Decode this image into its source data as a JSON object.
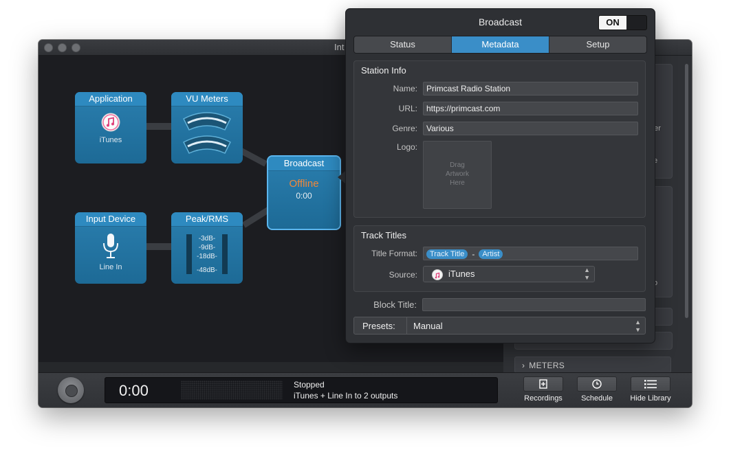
{
  "window": {
    "title": "Int"
  },
  "nodes": {
    "application": {
      "title": "Application",
      "sub": "iTunes"
    },
    "vu_meters": {
      "title": "VU Meters"
    },
    "input_device": {
      "title": "Input Device",
      "sub": "Line In"
    },
    "peak_rms": {
      "title": "Peak/RMS",
      "db_labels": [
        "-3dB-",
        "-9dB-",
        "-18dB-",
        "-48dB-"
      ]
    },
    "broadcast": {
      "title": "Broadcast",
      "status": "Offline",
      "time": "0:00"
    }
  },
  "library": {
    "fragments": [
      "ther",
      "e",
      "o"
    ],
    "meters_label": "METERS",
    "meters_chevron": "›"
  },
  "transport": {
    "time": "0:00",
    "status": "Stopped",
    "description": "iTunes + Line In to 2 outputs",
    "tools": [
      {
        "label": "Recordings",
        "icon": "recordings-icon"
      },
      {
        "label": "Schedule",
        "icon": "clock-icon"
      },
      {
        "label": "Hide Library",
        "icon": "list-icon"
      }
    ]
  },
  "popover": {
    "title": "Broadcast",
    "toggle": "ON",
    "tabs": [
      "Status",
      "Metadata",
      "Setup"
    ],
    "active_tab": "Metadata",
    "station_info": {
      "title": "Station Info",
      "name_label": "Name:",
      "name_value": "Primcast Radio Station",
      "url_label": "URL:",
      "url_value": "https://primcast.com",
      "genre_label": "Genre:",
      "genre_value": "Various",
      "logo_label": "Logo:",
      "logo_placeholder_1": "Drag",
      "logo_placeholder_2": "Artwork",
      "logo_placeholder_3": "Here"
    },
    "track_titles": {
      "title": "Track Titles",
      "format_label": "Title Format:",
      "token_1": "Track Title",
      "separator": "-",
      "token_2": "Artist",
      "source_label": "Source:",
      "source_value": "iTunes"
    },
    "block_title": {
      "label": "Block Title:",
      "value": ""
    },
    "presets": {
      "label": "Presets:",
      "value": "Manual"
    }
  },
  "colors": {
    "accent": "#3a8ec8",
    "node_blue": "#1d6a96",
    "offline": "#f0883a"
  }
}
